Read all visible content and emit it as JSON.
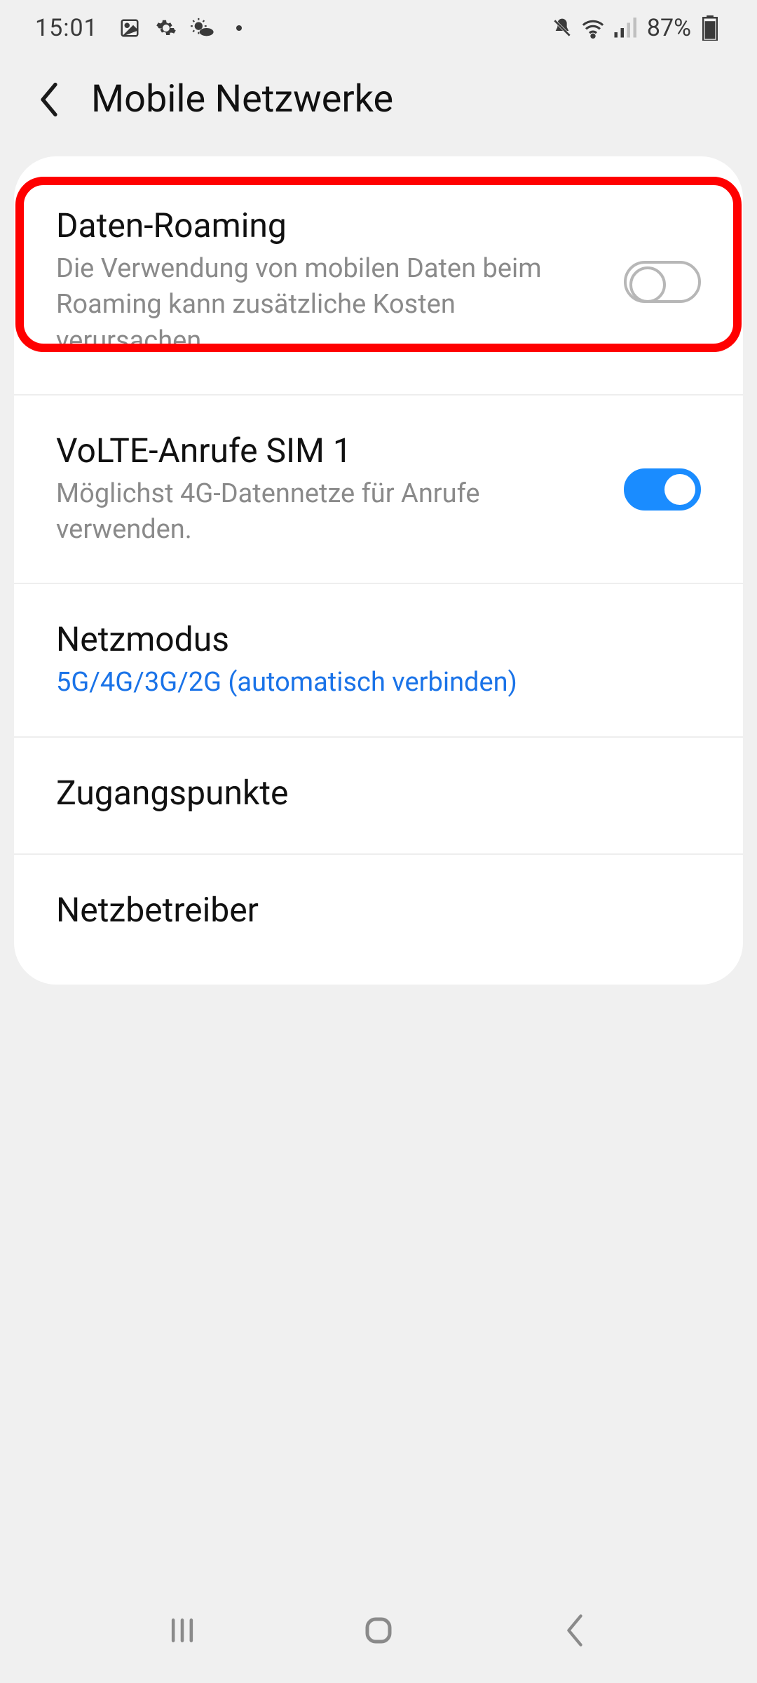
{
  "status": {
    "time": "15:01",
    "battery_text": "87%",
    "left_icons": [
      "gallery-icon",
      "gear-icon",
      "weather-icon",
      "dot-icon"
    ],
    "right_icons": [
      "mute-icon",
      "wifi-icon",
      "signal-icon"
    ]
  },
  "header": {
    "title": "Mobile Netzwerke"
  },
  "rows": [
    {
      "id": "data-roaming",
      "title": "Daten-Roaming",
      "subtitle": "Die Verwendung von mobilen Daten beim Roaming kann zusätzliche Kosten verursachen.",
      "toggle": "off",
      "link": false
    },
    {
      "id": "volte",
      "title": "VoLTE-Anrufe SIM 1",
      "subtitle": "Möglichst 4G-Datennetze für Anrufe verwenden.",
      "toggle": "on",
      "link": false
    },
    {
      "id": "net-mode",
      "title": "Netzmodus",
      "subtitle": "5G/4G/3G/2G (automatisch verbinden)",
      "toggle": null,
      "link": true
    },
    {
      "id": "apn",
      "title": "Zugangspunkte",
      "subtitle": "",
      "toggle": null,
      "link": false
    },
    {
      "id": "carrier",
      "title": "Netzbetreiber",
      "subtitle": "",
      "toggle": null,
      "link": false
    }
  ],
  "highlight": {
    "target_row": "data-roaming",
    "color": "#ff0000"
  }
}
